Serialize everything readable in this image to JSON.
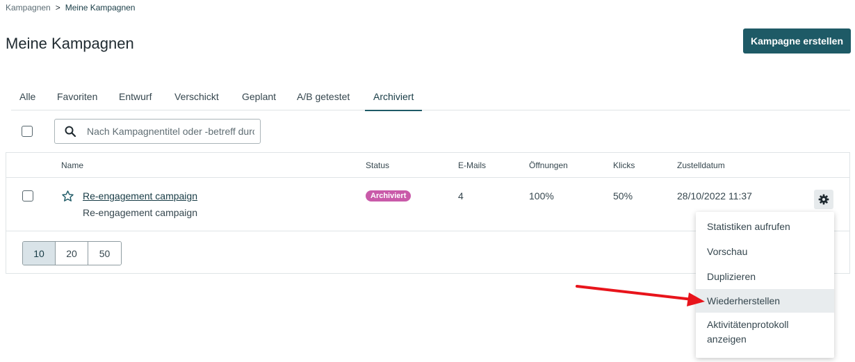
{
  "breadcrumb": {
    "parent": "Kampagnen",
    "separator": ">",
    "current": "Meine Kampagnen"
  },
  "page": {
    "title": "Meine Kampagnen",
    "create_button": "Kampagne erstellen"
  },
  "tabs": [
    {
      "label": "Alle"
    },
    {
      "label": "Favoriten"
    },
    {
      "label": "Entwurf"
    },
    {
      "label": "Verschickt"
    },
    {
      "label": "Geplant"
    },
    {
      "label": "A/B getestet"
    },
    {
      "label": "Archiviert",
      "active": true
    }
  ],
  "search": {
    "placeholder": "Nach Kampagnentitel oder -betreff durchsuchen",
    "value": ""
  },
  "table": {
    "columns": {
      "name": "Name",
      "status": "Status",
      "emails": "E-Mails",
      "opens": "Öffnungen",
      "clicks": "Klicks",
      "delivery": "Zustelldatum"
    },
    "rows": [
      {
        "title": "Re-engagement campaign",
        "subject": "Re-engagement campaign",
        "status": "Archiviert",
        "emails": "4",
        "opens": "100%",
        "clicks": "50%",
        "delivery": "28/10/2022 11:37"
      }
    ]
  },
  "pagination": {
    "sizes": [
      "10",
      "20",
      "50"
    ],
    "selected": "10"
  },
  "context_menu": {
    "items": [
      {
        "label": "Statistiken aufrufen"
      },
      {
        "label": "Vorschau"
      },
      {
        "label": "Duplizieren"
      },
      {
        "label": "Wiederherstellen",
        "highlighted": true
      },
      {
        "label": "Aktivitätenprotokoll anzeigen"
      }
    ]
  },
  "colors": {
    "accent": "#1e5a66",
    "badge": "#c95aa9",
    "annotation_arrow": "#e8141b"
  },
  "icons": {
    "search": "search-icon",
    "favorite": "star-outline-icon",
    "actions": "gear-icon",
    "annotation": "red-arrow-icon"
  }
}
